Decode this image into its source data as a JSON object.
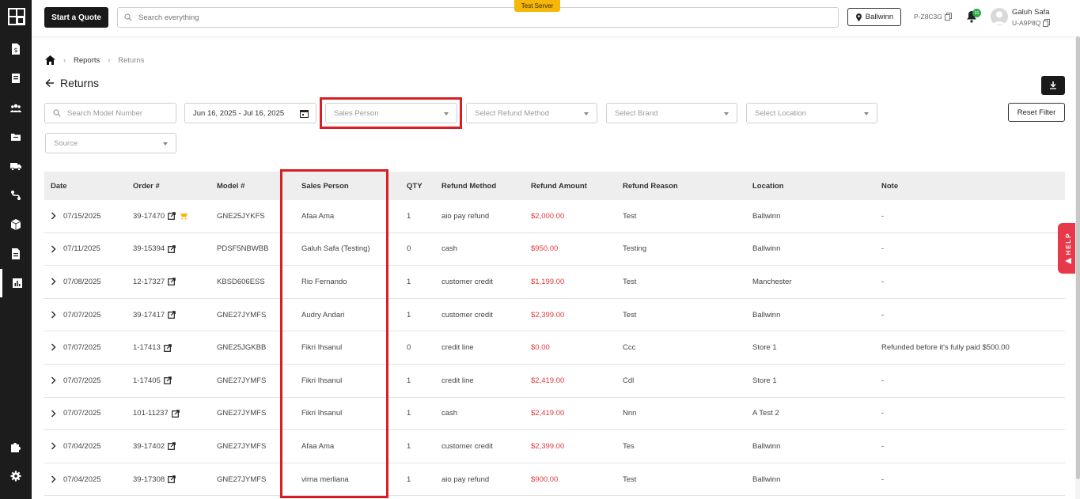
{
  "header": {
    "quote_label": "Start a Quote",
    "search_placeholder": "Search everything",
    "test_badge": "Test Server",
    "location": "Ballwinn",
    "code": "P-Z8C3G",
    "notification_count": "31",
    "user_name": "Galuh Safa",
    "user_id": "U-A9P8Q"
  },
  "breadcrumb": {
    "reports": "Reports",
    "current": "Returns"
  },
  "page": {
    "title": "Returns"
  },
  "filters": {
    "model_placeholder": "Search Model Number",
    "date_range": "Jun 16, 2025 - Jul 16, 2025",
    "sales_person": "Sales Person",
    "refund_method": "Select Refund Method",
    "brand": "Select Brand",
    "location": "Select Location",
    "source": "Source",
    "reset_label": "Reset Filter"
  },
  "table": {
    "columns": [
      "Date",
      "Order #",
      "Model #",
      "Sales Person",
      "QTY",
      "Refund Method",
      "Refund Amount",
      "Refund Reason",
      "Location",
      "Note"
    ],
    "rows": [
      {
        "date": "07/15/2025",
        "order": "39-17470",
        "model": "GNE25JYKFS",
        "sales": "Afaa Ama",
        "qty": "1",
        "method": "aio pay refund",
        "amount": "$2,000.00",
        "reason": "Test",
        "location": "Ballwinn",
        "note": "-"
      },
      {
        "date": "07/11/2025",
        "order": "39-15394",
        "model": "PDSF5NBWBB",
        "sales": "Galuh Safa (Testing)",
        "qty": "0",
        "method": "cash",
        "amount": "$950.00",
        "reason": "Testing",
        "location": "Ballwinn",
        "note": "-"
      },
      {
        "date": "07/08/2025",
        "order": "12-17327",
        "model": "KBSD606ESS",
        "sales": "Rio Fernando",
        "qty": "1",
        "method": "customer credit",
        "amount": "$1,199.00",
        "reason": "Test",
        "location": "Manchester",
        "note": "-"
      },
      {
        "date": "07/07/2025",
        "order": "39-17417",
        "model": "GNE27JYMFS",
        "sales": "Audry Andari",
        "qty": "1",
        "method": "customer credit",
        "amount": "$2,399.00",
        "reason": "Test",
        "location": "Ballwinn",
        "note": "-"
      },
      {
        "date": "07/07/2025",
        "order": "1-17413",
        "model": "GNE25JGKBB",
        "sales": "Fikri Ihsanul",
        "qty": "0",
        "method": "credit line",
        "amount": "$0.00",
        "reason": "Ccc",
        "location": "Store 1",
        "note": "Refunded before it's fully paid $500.00"
      },
      {
        "date": "07/07/2025",
        "order": "1-17405",
        "model": "GNE27JYMFS",
        "sales": "Fikri Ihsanul",
        "qty": "1",
        "method": "credit line",
        "amount": "$2,419.00",
        "reason": "Cdl",
        "location": "Store 1",
        "note": "-"
      },
      {
        "date": "07/07/2025",
        "order": "101-11237",
        "model": "GNE27JYMFS",
        "sales": "Fikri Ihsanul",
        "qty": "1",
        "method": "cash",
        "amount": "$2,419.00",
        "reason": "Nnn",
        "location": "A Test 2",
        "note": "-"
      },
      {
        "date": "07/04/2025",
        "order": "39-17402",
        "model": "GNE27JYMFS",
        "sales": "Afaa Ama",
        "qty": "1",
        "method": "customer credit",
        "amount": "$2,399.00",
        "reason": "Tes",
        "location": "Ballwinn",
        "note": "-"
      },
      {
        "date": "07/04/2025",
        "order": "39-17308",
        "model": "GNE27JYMFS",
        "sales": "virna merliana",
        "qty": "1",
        "method": "aio pay refund",
        "amount": "$900.00",
        "reason": "Test",
        "location": "Ballwinn",
        "note": "-"
      }
    ]
  },
  "help": {
    "label": "HELP"
  },
  "colors": {
    "accent": "#d81f26",
    "amount": "#e0393e",
    "sidebar": "#1c1c1c",
    "badge": "#f5b70a"
  }
}
